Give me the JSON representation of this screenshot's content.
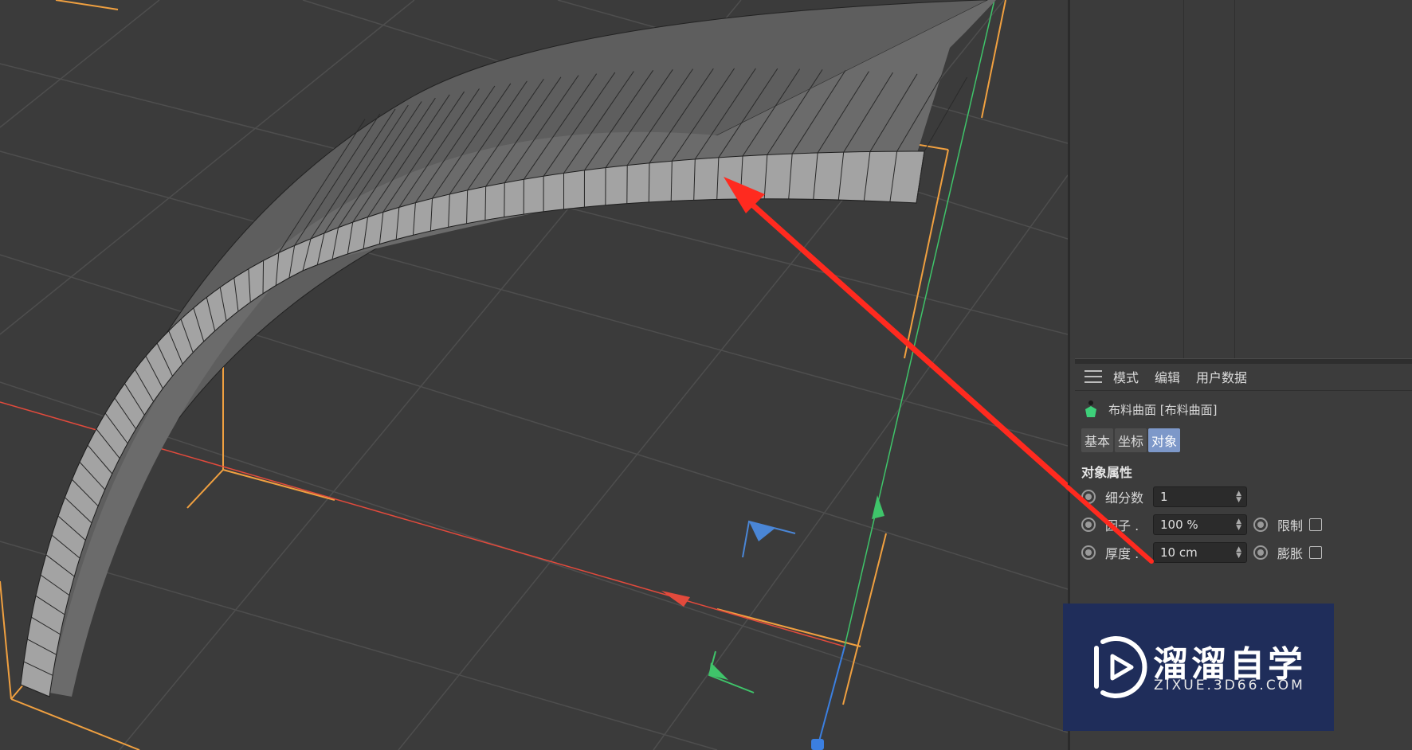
{
  "viewport": {
    "colors": {
      "background": "#3b3b3b",
      "grid": "#4c4c4c",
      "object_face": "#8c8c8c",
      "bbox_orange": "#f0a040",
      "axis_x": "#e24a3c",
      "axis_y": "#3fc46a",
      "axis_z": "#3b7fe0",
      "arrow": "#ff2a1f"
    }
  },
  "attributes": {
    "menu": {
      "hamburger_icon": "menu-icon",
      "items": [
        "模式",
        "编辑",
        "用户数据"
      ]
    },
    "object": {
      "icon": "cloth-surface-icon",
      "label": "布料曲面 [布料曲面]"
    },
    "tabs": [
      {
        "label": "基本",
        "active": false
      },
      {
        "label": "坐标",
        "active": false
      },
      {
        "label": "对象",
        "active": true
      }
    ],
    "section_title": "对象属性",
    "params": [
      {
        "label": "细分数",
        "value": "1"
      },
      {
        "label": "因子 .",
        "value": "100 %",
        "extra_label": "限制",
        "extra_checked": false
      },
      {
        "label": "厚度 .",
        "value": "10 cm",
        "extra_label": "膨胀",
        "extra_checked": false
      }
    ]
  },
  "watermark": {
    "title": "溜溜自学",
    "subtitle": "ZIXUE.3D66.COM",
    "logo": "play-logo-icon"
  }
}
